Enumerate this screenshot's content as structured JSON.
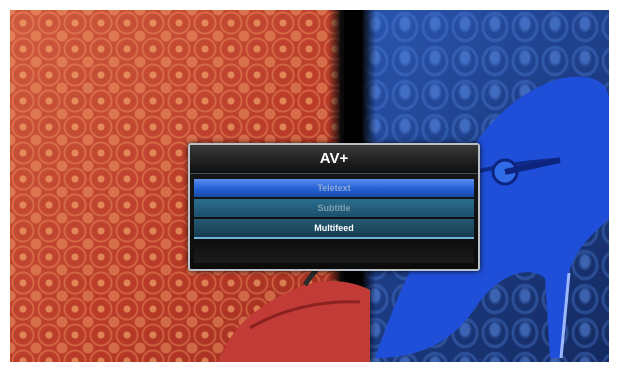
{
  "menu": {
    "title": "AV+",
    "items": [
      {
        "label": "Teletext",
        "state": "highlighted"
      },
      {
        "label": "Subtitle",
        "state": "disabled"
      },
      {
        "label": "Multifeed",
        "state": "enabled"
      }
    ]
  },
  "background": {
    "left_color": "#c4452f",
    "right_color": "#1f3f86",
    "divider_color": "#000000",
    "description_icons": [
      "red-shoe-image",
      "blue-shoe-image"
    ]
  },
  "colors": {
    "highlight": "#2360d4",
    "menu_border": "#b9c0c8",
    "menu_bg": "#0b0b0b"
  }
}
